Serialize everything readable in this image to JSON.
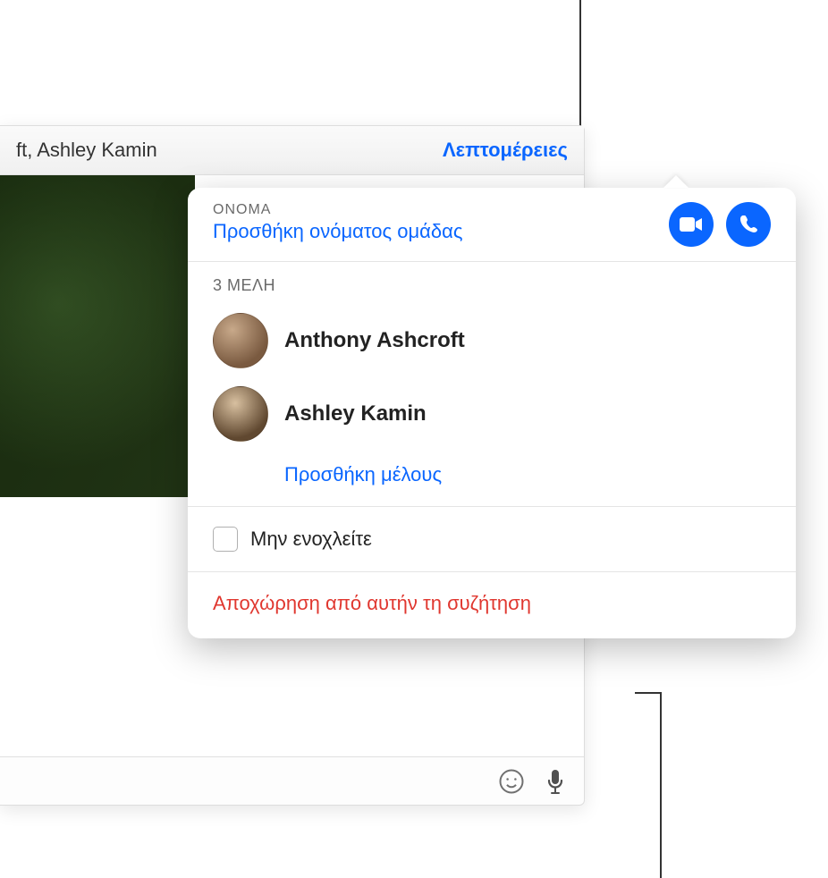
{
  "header": {
    "title_suffix": "ft, Ashley Kamin",
    "details_label": "Λεπτομέρειες"
  },
  "popover": {
    "name_section_label": "ΟΝΟΜΑ",
    "add_group_name": "Προσθήκη ονόματος ομάδας",
    "members_count_label": "3 ΜΕΛΗ",
    "members": [
      {
        "name": "Anthony Ashcroft"
      },
      {
        "name": "Ashley Kamin"
      }
    ],
    "add_member_label": "Προσθήκη μέλους",
    "dnd_label": "Μην ενοχλείτε",
    "leave_label": "Αποχώρηση από αυτήν τη συζήτηση"
  }
}
